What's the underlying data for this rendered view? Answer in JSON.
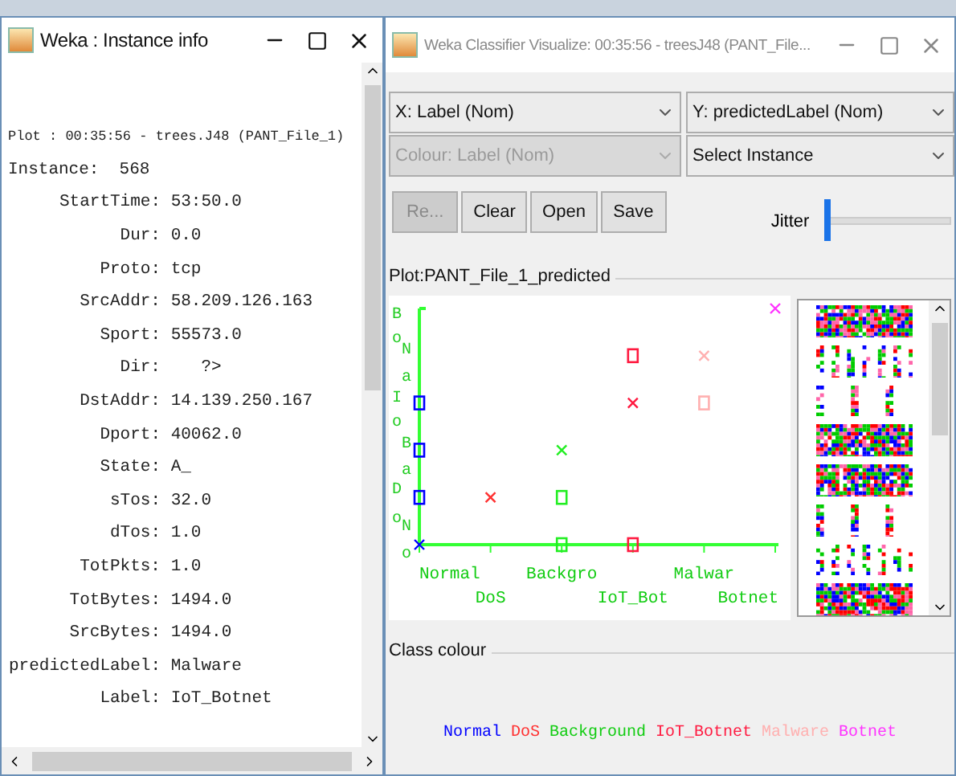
{
  "info_window": {
    "title": "Weka : Instance info",
    "lines": [
      {
        "kind": "header",
        "text": "Plot : 00:35:56 - trees.J48 (PANT_File_1)"
      },
      {
        "kind": "header",
        "text": "Instance:  568"
      },
      {
        "kind": "field",
        "label": "StartTime:",
        "value": "53:50.0"
      },
      {
        "kind": "field",
        "label": "Dur:",
        "value": "0.0"
      },
      {
        "kind": "field",
        "label": "Proto:",
        "value": "tcp"
      },
      {
        "kind": "field",
        "label": "SrcAddr:",
        "value": "58.209.126.163"
      },
      {
        "kind": "field",
        "label": "Sport:",
        "value": "55573.0"
      },
      {
        "kind": "field",
        "label": "Dir:",
        "value": "   ?>"
      },
      {
        "kind": "field",
        "label": "DstAddr:",
        "value": "14.139.250.167"
      },
      {
        "kind": "field",
        "label": "Dport:",
        "value": "40062.0"
      },
      {
        "kind": "field",
        "label": "State:",
        "value": "A_"
      },
      {
        "kind": "field",
        "label": "sTos:",
        "value": "32.0"
      },
      {
        "kind": "field",
        "label": "dTos:",
        "value": "1.0"
      },
      {
        "kind": "field",
        "label": "TotPkts:",
        "value": "1.0"
      },
      {
        "kind": "field",
        "label": "TotBytes:",
        "value": "1494.0"
      },
      {
        "kind": "field",
        "label": "SrcBytes:",
        "value": "1494.0"
      },
      {
        "kind": "field",
        "label": "predictedLabel:",
        "value": "Malware"
      },
      {
        "kind": "field",
        "label": "Label:",
        "value": "IoT_Botnet"
      }
    ]
  },
  "visualize_window": {
    "title": "Weka Classifier Visualize: 00:35:56 - treesJ48 (PANT_File...",
    "selectors": [
      {
        "value": "X: Label (Nom)",
        "disabled": false
      },
      {
        "value": "Y: predictedLabel (Nom)",
        "disabled": false
      },
      {
        "value": "Colour: Label (Nom)",
        "disabled": true
      },
      {
        "value": "Select Instance",
        "disabled": false
      }
    ],
    "buttons": [
      {
        "label": "Re...",
        "disabled": true
      },
      {
        "label": "Clear",
        "disabled": false
      },
      {
        "label": "Open",
        "disabled": false
      },
      {
        "label": "Save",
        "disabled": false
      }
    ],
    "jitter": {
      "label": "Jitter",
      "level": 0
    },
    "plot": {
      "title": "Plot:PANT_File_1_predicted",
      "x_labels": [
        "Normal",
        "DoS",
        "Backgro",
        "IoT_Bot",
        "Malwar",
        "Botnet"
      ],
      "y_labels": [
        "B",
        "o",
        "N",
        "a",
        "I",
        "o",
        "B",
        "a",
        "D",
        "o",
        "N",
        "o"
      ]
    },
    "thumbnails": [
      {
        "kind": "dense"
      },
      {
        "kind": "sparse"
      },
      {
        "kind": "columns"
      },
      {
        "kind": "dense"
      },
      {
        "kind": "dense"
      },
      {
        "kind": "columns"
      },
      {
        "kind": "sparse"
      },
      {
        "kind": "dense"
      }
    ],
    "class_colour": {
      "title": "Class colour",
      "legend": [
        {
          "label": "Normal",
          "color": "#0000ff"
        },
        {
          "label": "DoS",
          "color": "#ff3030"
        },
        {
          "label": "Background",
          "color": "#11cc11"
        },
        {
          "label": "IoT_Botnet",
          "color": "#ff1a40"
        },
        {
          "label": "Malware",
          "color": "#ffb0b0"
        },
        {
          "label": "Botnet",
          "color": "#ff33ff"
        }
      ]
    }
  }
}
